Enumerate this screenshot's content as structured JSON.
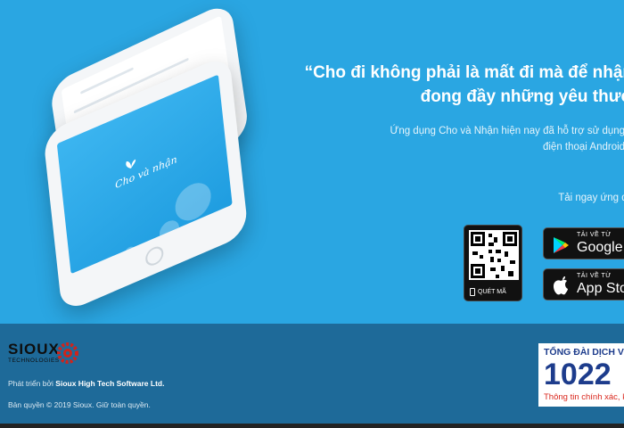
{
  "hero": {
    "quote_line1": "“Cho đi không phải là mất đi mà để nhận",
    "quote_line2": "đong đầy những yêu thươ",
    "desc_line1": "Ứng dụng Cho và Nhận hiện nay đã hỗ trợ sử dụng c",
    "desc_line2": "điện thoại Android v",
    "download_label": "Tải ngay ứng dụ",
    "app_name": "Cho và nhận"
  },
  "qr": {
    "caption": "QUÉT MÃ",
    "icon": "qr-code-icon"
  },
  "stores": {
    "google_small": "TẢI VỀ TỪ",
    "google_big": "Google P",
    "apple_small": "TẢI VỀ TỪ",
    "apple_big": "App Sto"
  },
  "footer": {
    "logo_word": "SIOUX",
    "logo_sub": "TECHNOLOGIES",
    "dev_prefix": "Phát triển bởi ",
    "dev_company": "Sioux High Tech Software Ltd.",
    "copyright": "Bản quyền © 2019 Sioux. Giữ toàn quyền.",
    "hotline_title": "TỔNG ĐÀI DỊCH VỤ C",
    "hotline_number": "1022",
    "hotline_sub": "Thông tin chính xác, k"
  },
  "colors": {
    "hero_bg": "#2aa6e2",
    "footer_bg": "#1e6a99",
    "hotline_blue": "#1d3c8c",
    "hotline_red": "#d9261c"
  }
}
